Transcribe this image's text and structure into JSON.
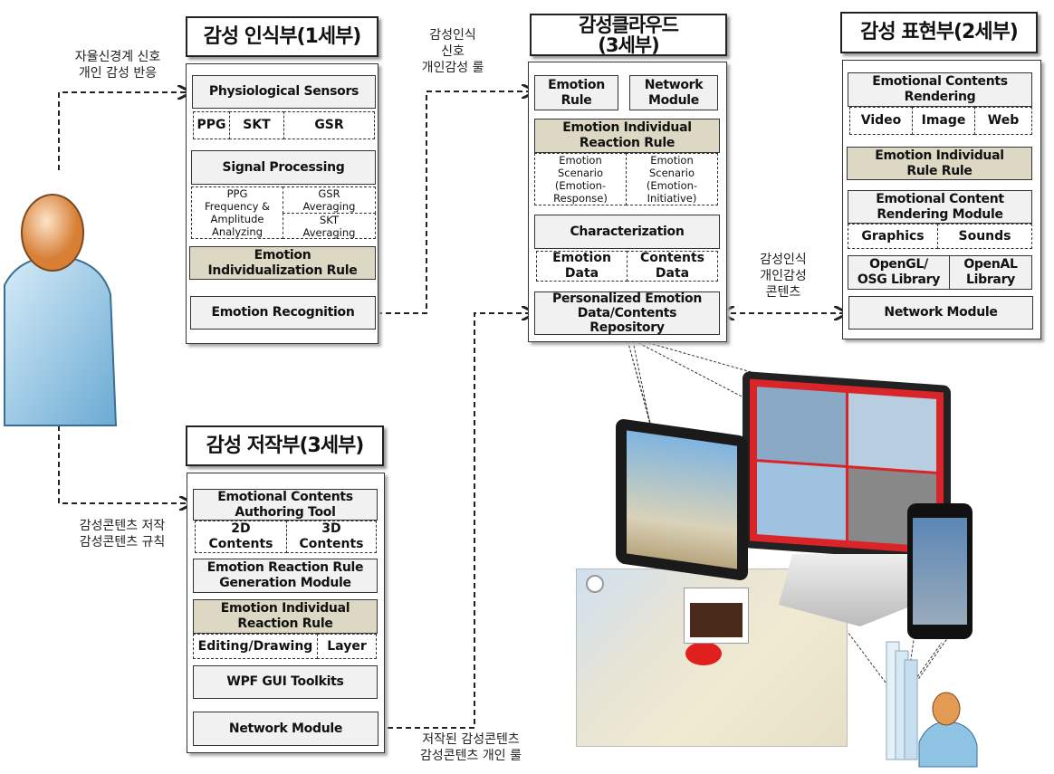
{
  "recognition": {
    "title": "감성 인식부(1세부)",
    "physiological_sensors": "Physiological Sensors",
    "sensors": [
      "PPG",
      "SKT",
      "GSR"
    ],
    "signal_processing": "Signal Processing",
    "ppg_analyzing": "PPG\nFrequency &\nAmplitude\nAnalyzing",
    "gsr_averaging": "GSR\nAveraging",
    "skt_averaging": "SKT\nAveraging",
    "individualization_rule": "Emotion\nIndividualization Rule",
    "emotion_recognition": "Emotion Recognition"
  },
  "authoring": {
    "title": "감성 저작부(3세부)",
    "authoring_tool": "Emotional Contents\nAuthoring Tool",
    "contents_2d": "2D\nContents",
    "contents_3d": "3D\nContents",
    "rule_generation": "Emotion Reaction Rule\nGeneration Module",
    "individual_reaction_rule": "Emotion Individual\nReaction Rule",
    "editing": "Editing/Drawing",
    "layer": "Layer",
    "wpf": "WPF GUI Toolkits",
    "network": "Network Module"
  },
  "cloud": {
    "title": "감성클라우드\n(3세부)",
    "emotion_rule": "Emotion\nRule",
    "network_module": "Network\nModule",
    "individual_reaction_rule": "Emotion Individual\nReaction Rule",
    "scenario_response": "Emotion\nScenario\n(Emotion-\nResponse)",
    "scenario_initiative": "Emotion\nScenario\n(Emotion-\nInitiative)",
    "characterization": "Characterization",
    "emotion_data": "Emotion\nData",
    "contents_data": "Contents\nData",
    "repository": "Personalized Emotion\nData/Contents\nRepository"
  },
  "expression": {
    "title": "감성 표현부(2세부)",
    "contents_rendering": "Emotional Contents\nRendering",
    "media": [
      "Video",
      "Image",
      "Web"
    ],
    "individual_rule": "Emotion Individual\nRule Rule",
    "rendering_module": "Emotional Content\nRendering Module",
    "graphics": "Graphics",
    "sounds": "Sounds",
    "opengl": "OpenGL/\nOSG Library",
    "openal": "OpenAL\nLibrary",
    "network": "Network Module"
  },
  "labels": {
    "user_to_recognition": "자율신경계 신호\n개인 감성 반응",
    "recognition_to_cloud": "감성인식\n신호\n개인감성 룰",
    "cloud_to_expression": "감성인식\n개인감성\n콘텐츠",
    "user_to_authoring": "감성콘텐츠 저작\n감성콘텐츠 규칙",
    "authoring_to_cloud": "저작된 감성콘텐츠\n감성콘텐츠 개인 룰"
  },
  "colors": {
    "rule_fill": "#ddd8c4",
    "box_fill": "#f1f1f1",
    "person_body": "#8fc3e3",
    "person_head": "#e39a52"
  }
}
